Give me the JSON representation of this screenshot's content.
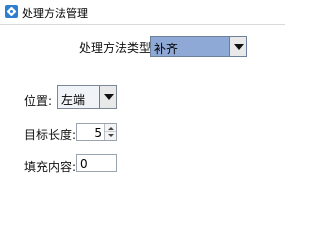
{
  "window": {
    "title": "处理方法管理",
    "icon": "app-gear-icon"
  },
  "form": {
    "method_type_label": "处理方法类型:",
    "method_type_value": "补齐",
    "position_label": "位置:",
    "position_value": "左端",
    "target_length_label": "目标长度:",
    "target_length_value": "5",
    "fill_content_label": "填充内容:",
    "fill_content_value": "0"
  },
  "colors": {
    "selected_combo_bg": "#8ea9d6",
    "accent": "#2f7fd1"
  }
}
